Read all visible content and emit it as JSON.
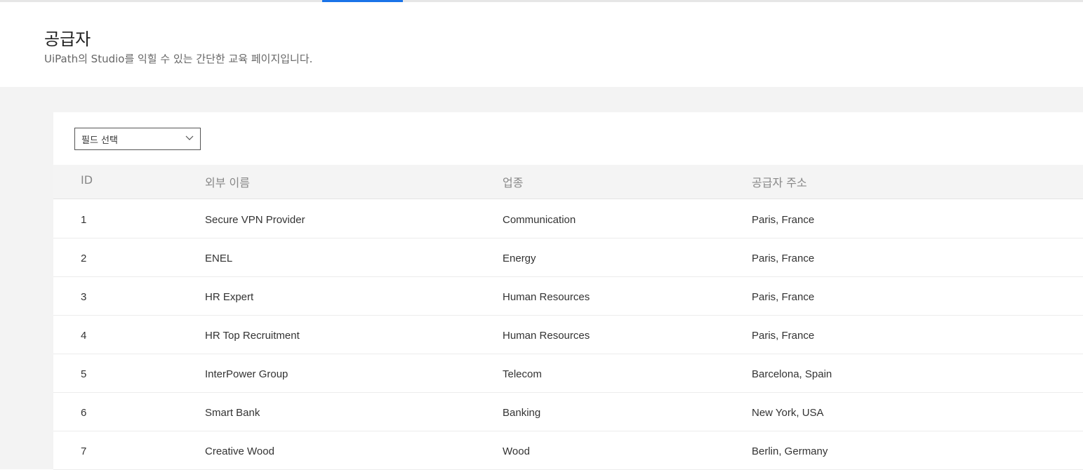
{
  "header": {
    "title": "공급자",
    "subtitle": "UiPath의 Studio를 익힐 수 있는 간단한 교육 페이지입니다."
  },
  "filter": {
    "placeholder": "필드 선택"
  },
  "table": {
    "columns": [
      "ID",
      "외부 이름",
      "업종",
      "공급자 주소"
    ],
    "rows": [
      {
        "id": "1",
        "name": "Secure VPN Provider",
        "industry": "Communication",
        "address": "Paris, France"
      },
      {
        "id": "2",
        "name": "ENEL",
        "industry": "Energy",
        "address": "Paris, France"
      },
      {
        "id": "3",
        "name": "HR Expert",
        "industry": "Human Resources",
        "address": "Paris, France"
      },
      {
        "id": "4",
        "name": "HR Top Recruitment",
        "industry": "Human Resources",
        "address": "Paris, France"
      },
      {
        "id": "5",
        "name": "InterPower Group",
        "industry": "Telecom",
        "address": "Barcelona, Spain"
      },
      {
        "id": "6",
        "name": "Smart Bank",
        "industry": "Banking",
        "address": "New York, USA"
      },
      {
        "id": "7",
        "name": "Creative Wood",
        "industry": "Wood",
        "address": "Berlin, Germany"
      }
    ]
  },
  "colors": {
    "accent": "#1a73e8",
    "content_bg": "#f3f3f3",
    "header_row_bg": "#f4f4f4"
  }
}
